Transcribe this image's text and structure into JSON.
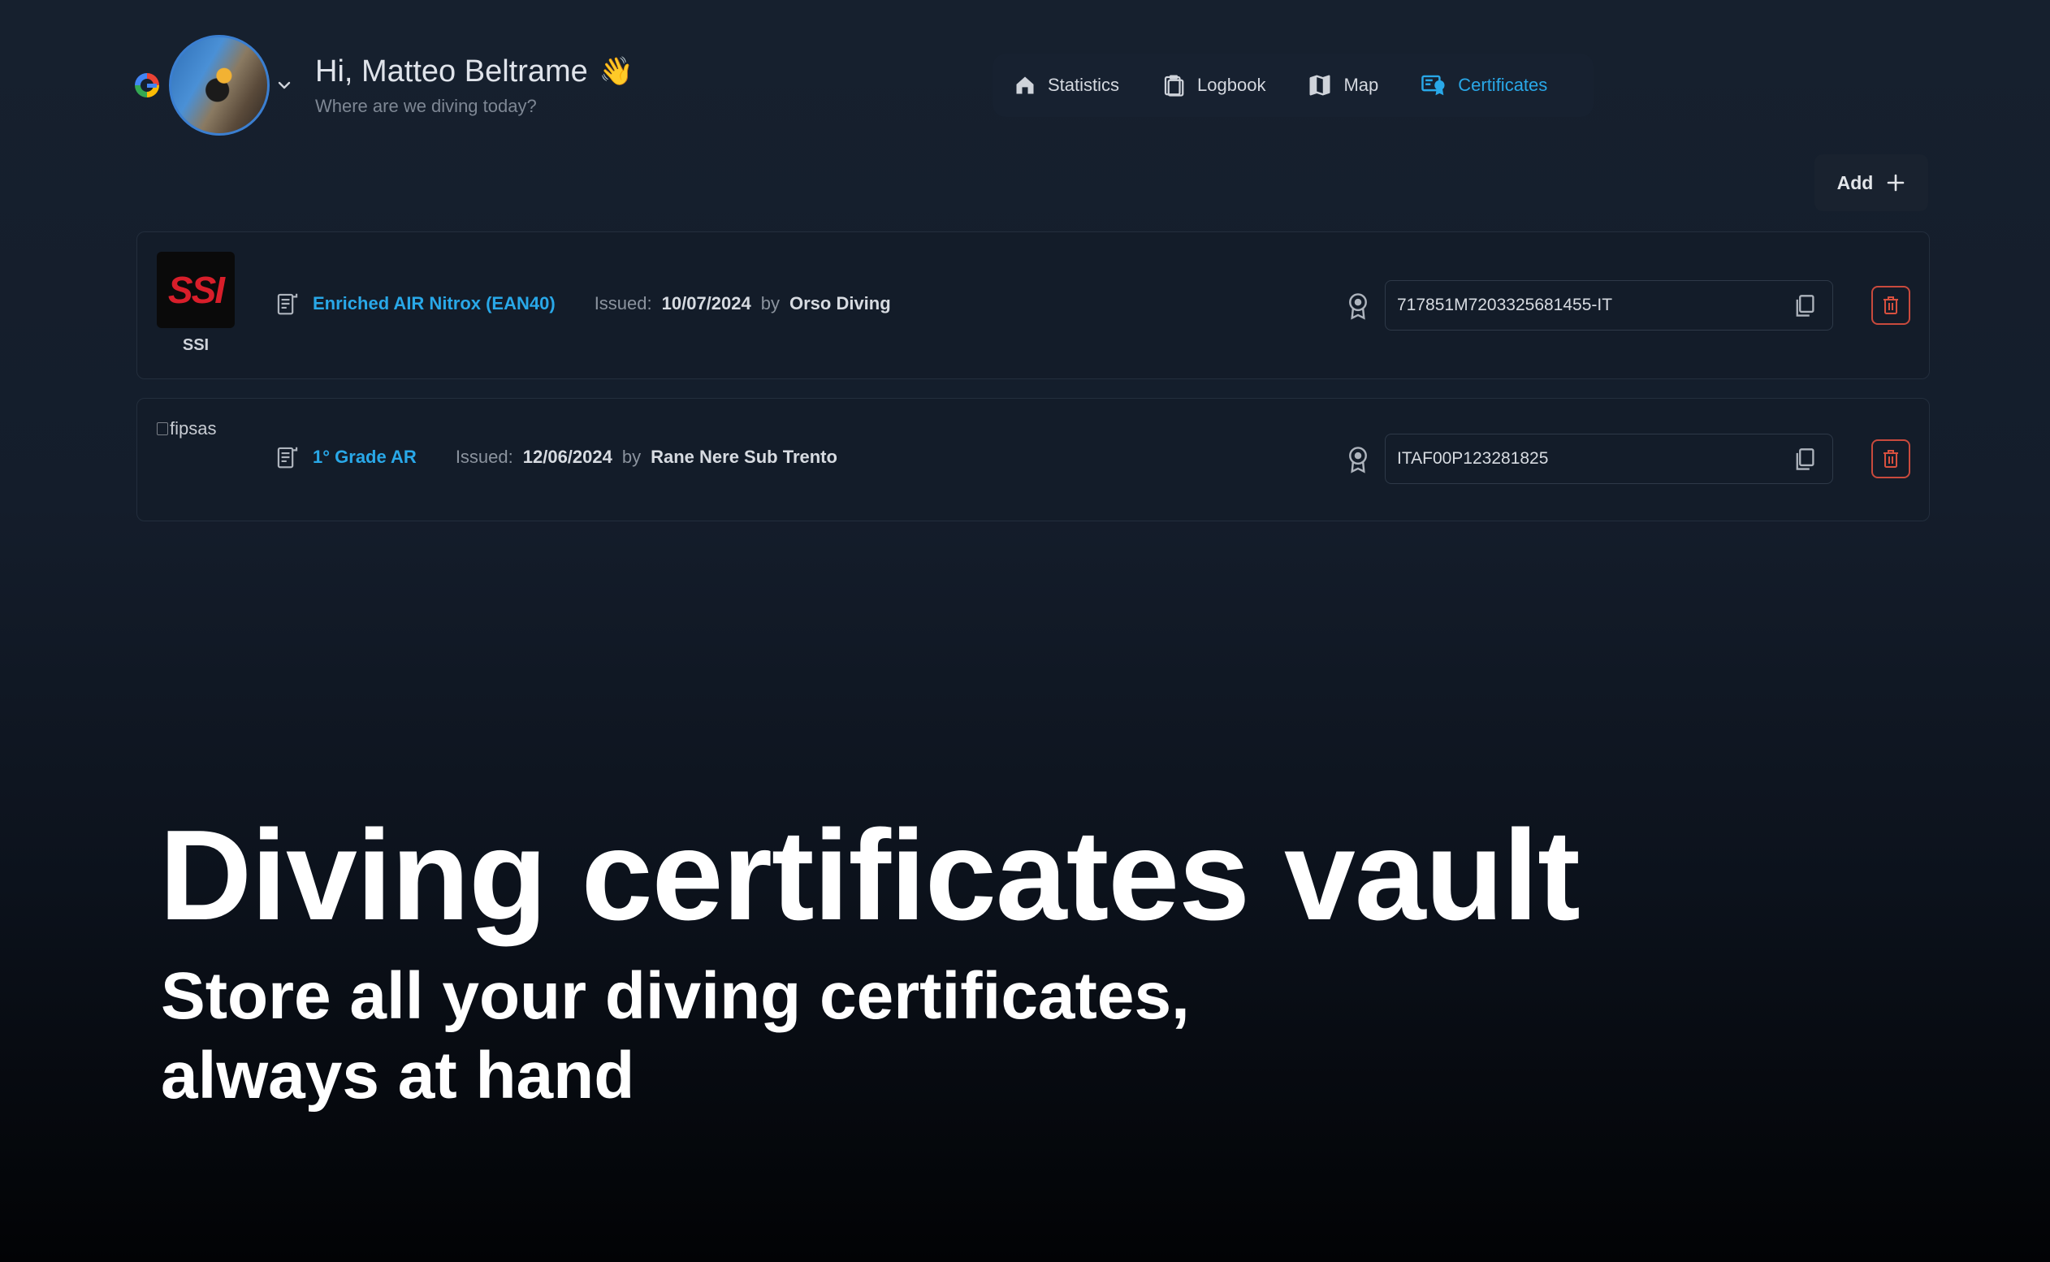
{
  "header": {
    "greeting": "Hi, Matteo Beltrame",
    "wave_emoji": "👋",
    "subtitle": "Where are we diving today?"
  },
  "nav": {
    "items": [
      {
        "label": "Statistics",
        "icon": "home-icon"
      },
      {
        "label": "Logbook",
        "icon": "clipboard-icon"
      },
      {
        "label": "Map",
        "icon": "map-icon"
      },
      {
        "label": "Certificates",
        "icon": "certificate-icon",
        "active": true
      }
    ],
    "active_color": "#29a8e8"
  },
  "actions": {
    "add_label": "Add"
  },
  "certificates": [
    {
      "org_logo_text": "SSI",
      "org_label": "SSI",
      "name": "Enriched AIR Nitrox (EAN40)",
      "issued_label": "Issued:",
      "issued_date": "10/07/2024",
      "by_label": "by",
      "issuer": "Orso Diving",
      "cert_id": "717851M7203325681455-IT"
    },
    {
      "org_logo_alt": "fipsas",
      "name": "1° Grade AR",
      "issued_label": "Issued:",
      "issued_date": "12/06/2024",
      "by_label": "by",
      "issuer": "Rane Nere Sub Trento",
      "cert_id": "ITAF00P123281825"
    }
  ],
  "hero": {
    "title": "Diving certificates vault",
    "subtitle_line1": "Store all your diving certificates,",
    "subtitle_line2": "always at hand"
  },
  "colors": {
    "accent": "#29a8e8",
    "danger": "#c94a3d",
    "ssi_red": "#d81e2a"
  }
}
